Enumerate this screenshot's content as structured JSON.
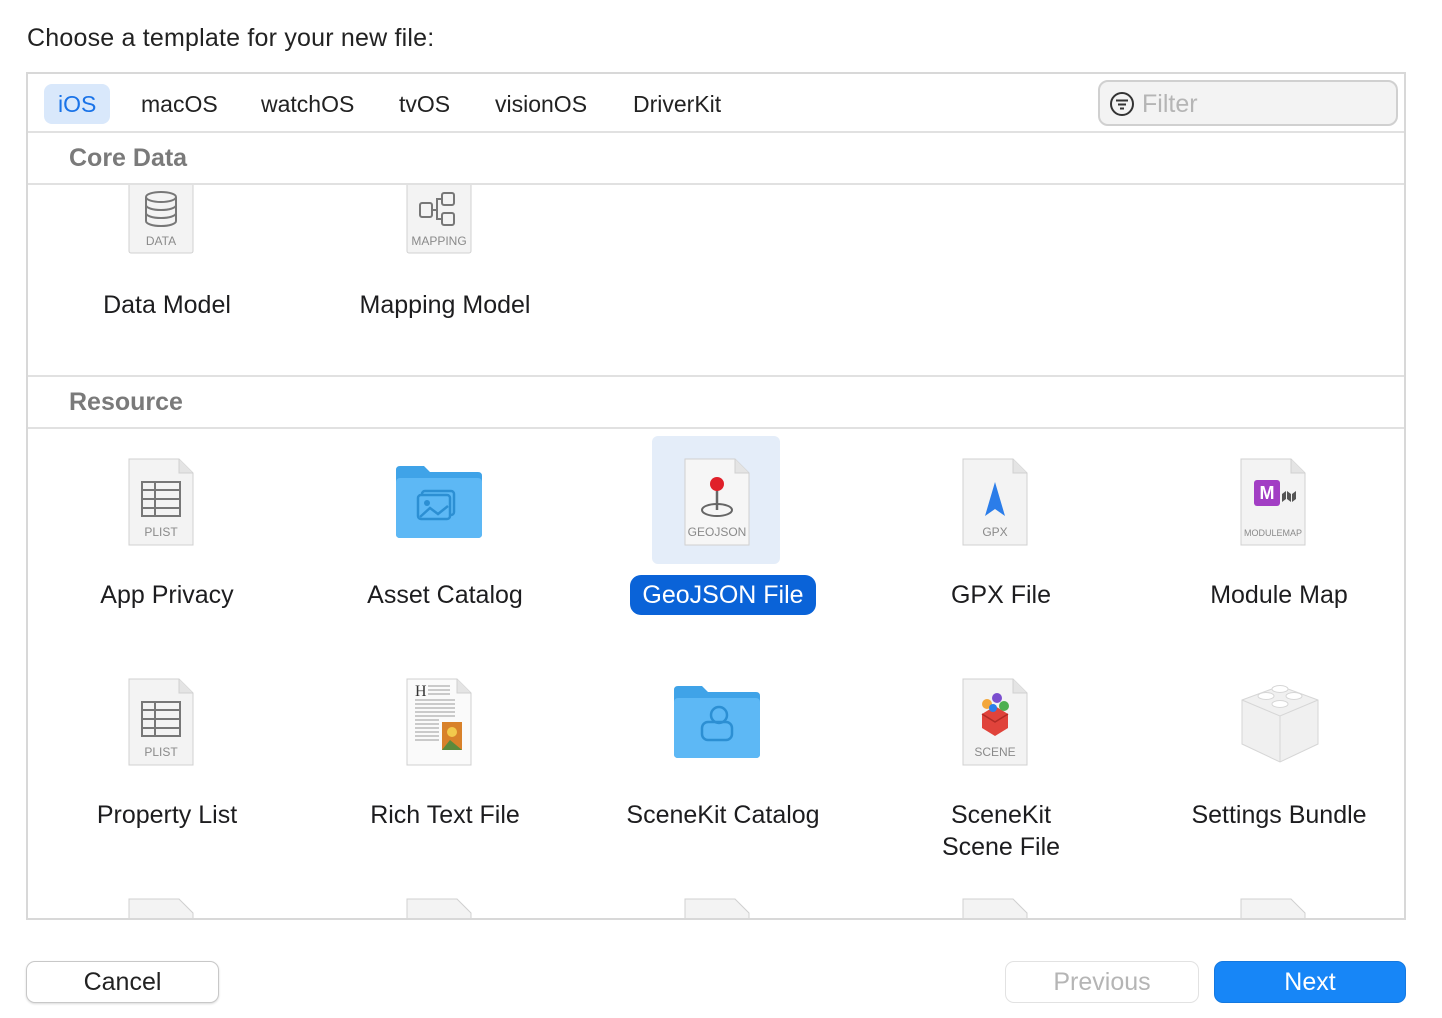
{
  "prompt": "Choose a template for your new file:",
  "tabs": [
    {
      "label": "iOS",
      "active": true
    },
    {
      "label": "macOS",
      "active": false
    },
    {
      "label": "watchOS",
      "active": false
    },
    {
      "label": "tvOS",
      "active": false
    },
    {
      "label": "visionOS",
      "active": false
    },
    {
      "label": "DriverKit",
      "active": false
    }
  ],
  "filter": {
    "placeholder": "Filter",
    "value": ""
  },
  "sections": {
    "core_data": {
      "title": "Core Data",
      "items": [
        {
          "label": "Data Model",
          "badge": "DATA",
          "icon": "database-icon"
        },
        {
          "label": "Mapping Model",
          "badge": "MAPPING",
          "icon": "mapping-icon"
        }
      ]
    },
    "resource": {
      "title": "Resource",
      "items": [
        {
          "label": "App Privacy",
          "badge": "PLIST",
          "icon": "plist-icon"
        },
        {
          "label": "Asset Catalog",
          "badge": "",
          "icon": "asset-folder-icon"
        },
        {
          "label": "GeoJSON File",
          "badge": "GEOJSON",
          "icon": "map-pin-icon",
          "selected": true
        },
        {
          "label": "GPX File",
          "badge": "GPX",
          "icon": "location-arrow-icon"
        },
        {
          "label": "Module Map",
          "badge": "MODULEMAP",
          "icon": "module-map-icon"
        },
        {
          "label": "Property List",
          "badge": "PLIST",
          "icon": "plist-icon"
        },
        {
          "label": "Rich Text File",
          "badge": "",
          "icon": "rich-text-icon"
        },
        {
          "label": "SceneKit Catalog",
          "badge": "",
          "icon": "scenekit-folder-icon"
        },
        {
          "label_line1": "SceneKit",
          "label_line2": "Scene File",
          "badge": "SCENE",
          "icon": "scene-icon"
        },
        {
          "label": "Settings Bundle",
          "badge": "",
          "icon": "settings-bundle-icon"
        }
      ]
    }
  },
  "buttons": {
    "cancel": "Cancel",
    "previous": "Previous",
    "next": "Next"
  },
  "colors": {
    "accent": "#1786f7",
    "selection": "#0a63d8",
    "selection_bg": "#e4edf9",
    "tab_active_bg": "#d9e8fb",
    "folder_blue": "#5db8f5"
  }
}
